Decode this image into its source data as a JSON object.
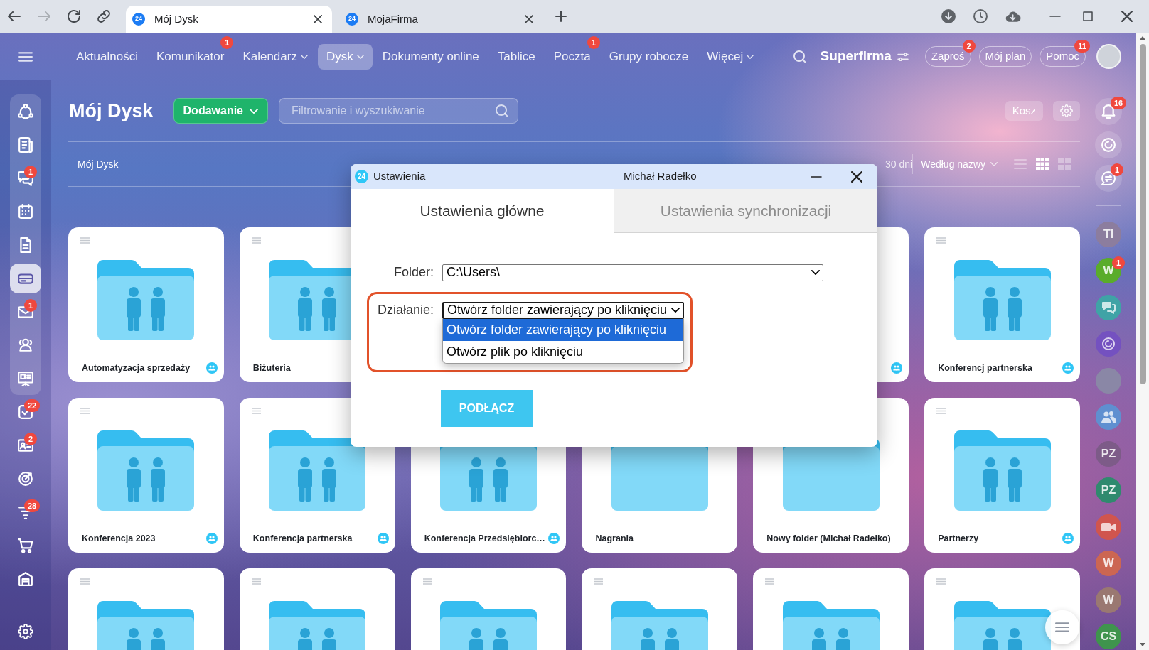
{
  "browser": {
    "back_disabled": false,
    "forward_disabled": true,
    "tabs": [
      {
        "logo": "24",
        "title": "Mój Dysk",
        "selected": true
      },
      {
        "logo": "24",
        "title": "MojaFirma",
        "selected": false
      }
    ]
  },
  "top_nav": {
    "items": [
      {
        "label": "Aktualności",
        "selected": false,
        "dropdown": false
      },
      {
        "label": "Komunikator",
        "selected": false,
        "dropdown": false,
        "badge": "1"
      },
      {
        "label": "Kalendarz",
        "selected": false,
        "dropdown": true
      },
      {
        "label": "Dysk",
        "selected": true,
        "dropdown": true
      },
      {
        "label": "Dokumenty online",
        "selected": false,
        "dropdown": false
      },
      {
        "label": "Tablice",
        "selected": false,
        "dropdown": false
      },
      {
        "label": "Poczta",
        "selected": false,
        "dropdown": false,
        "badge": "1"
      },
      {
        "label": "Grupy robocze",
        "selected": false,
        "dropdown": false
      },
      {
        "label": "Więcej",
        "selected": false,
        "dropdown": true
      }
    ],
    "company": "Superfirma",
    "buttons": [
      {
        "label": "Zaproś",
        "badge": "2"
      },
      {
        "label": "Mój plan"
      },
      {
        "label": "Pomoc",
        "badge": "11"
      }
    ]
  },
  "left_sidebar": {
    "pinned": [
      {
        "selected": false
      },
      {
        "selected": false
      },
      {
        "selected": false,
        "badge": "1"
      },
      {
        "selected": false
      },
      {
        "selected": false
      },
      {
        "selected": true
      },
      {
        "selected": false,
        "badge": "1"
      },
      {
        "selected": false
      },
      {
        "selected": false
      }
    ],
    "more": [
      {
        "selected": false,
        "badge": "22"
      },
      {
        "selected": false,
        "badge": "2"
      },
      {
        "selected": false
      },
      {
        "selected": false,
        "badge": "28"
      },
      {
        "selected": false
      },
      {
        "selected": false
      }
    ]
  },
  "right_sidebar": {
    "notifications": {
      "badge": "16"
    },
    "messages": {
      "badge": "1"
    },
    "chats": [
      {
        "kind": "initials",
        "initials": "TI",
        "color": "#8c7d9e"
      },
      {
        "kind": "initials",
        "initials": "W",
        "color": "#5aac2a",
        "badge": "1"
      },
      {
        "kind": "icon",
        "color": "#3fa3a6"
      },
      {
        "kind": "icon",
        "color": "#7451c0"
      },
      {
        "kind": "photo"
      },
      {
        "kind": "icon",
        "color": "#5f8fd0"
      },
      {
        "kind": "initials",
        "initials": "PZ",
        "color": "#7d5b88"
      },
      {
        "kind": "initials",
        "initials": "PZ",
        "color": "#2f8a6e"
      },
      {
        "kind": "icon",
        "color": "#d0554e"
      },
      {
        "kind": "initials",
        "initials": "W",
        "color": "#cc6652"
      },
      {
        "kind": "initials",
        "initials": "W",
        "color": "#9a7871"
      },
      {
        "kind": "initials",
        "initials": "CS",
        "color": "#3f944d"
      }
    ]
  },
  "page": {
    "title": "Mój Dysk",
    "add_button": "Dodawanie",
    "search": {
      "placeholder": "Filtrowanie i wyszukiwanie"
    },
    "trash_button": "Kosz",
    "breadcrumb": "Mój Dysk",
    "notice": "30 dni",
    "sort": "Według nazwy",
    "view_modes": [
      {
        "selected": false
      },
      {
        "selected": true
      },
      {
        "selected": false
      }
    ],
    "folders": [
      {
        "name": "Automatyzacja sprzedaży",
        "kind": "group",
        "shared": true
      },
      {
        "name": "Biżuteria",
        "kind": "group"
      },
      {
        "shared": true
      },
      {
        "name": "Konferencj partnerska",
        "kind": "group",
        "shared": true
      },
      {
        "name": "Konferencja 2023",
        "kind": "group",
        "shared": true
      },
      {
        "name": "Konferencja partnerska",
        "kind": "group",
        "shared": true
      },
      {
        "name": "Konferencja Przedsiębiorc…",
        "kind": "group",
        "shared": true
      },
      {
        "name": "Nagrania",
        "kind": "plain",
        "shared": false
      },
      {
        "name": "Nowy folder (Michał Radełko)",
        "kind": "plain",
        "shared": false
      },
      {
        "name": "Partnerzy",
        "kind": "group",
        "shared": true
      },
      {
        "kind": "group"
      },
      {
        "kind": "group"
      },
      {
        "kind": "group"
      },
      {
        "kind": "group"
      },
      {
        "kind": "group"
      },
      {
        "kind": "group"
      }
    ]
  },
  "dialog": {
    "logo": "24",
    "title": "Ustawienia",
    "user": "Michał Radełko",
    "tabs": [
      {
        "label": "Ustawienia główne",
        "selected": true
      },
      {
        "label": "Ustawienia synchronizacji",
        "selected": false
      }
    ],
    "fields": [
      {
        "kind": "path",
        "label": "Folder:",
        "value": "C:\\Users\\",
        "expanded": false,
        "highlighted": false
      },
      {
        "kind": "select",
        "label": "Działanie:",
        "value": "Otwórz folder zawierający po kliknięciu",
        "expanded": true,
        "highlighted": true,
        "options": [
          {
            "label": "Otwórz folder zawierający po kliknięciu",
            "selected": true
          },
          {
            "label": "Otwórz plik po kliknięciu",
            "selected": false
          }
        ]
      }
    ],
    "button": "PODŁĄCZ"
  }
}
